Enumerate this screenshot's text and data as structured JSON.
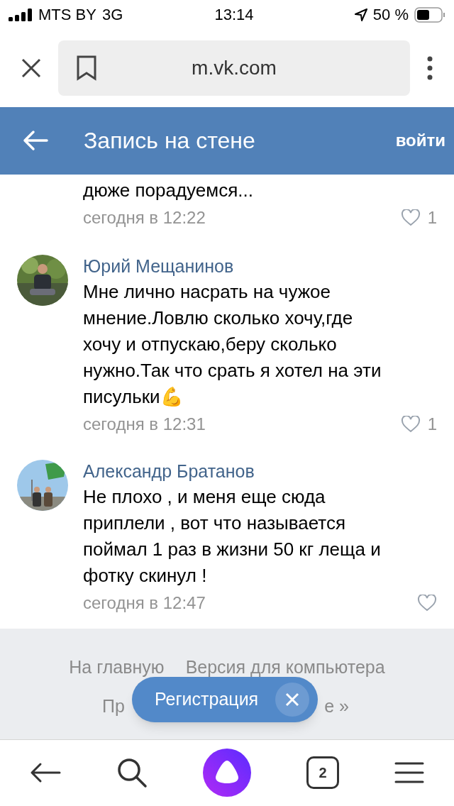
{
  "status_bar": {
    "carrier": "MTS BY",
    "network": "3G",
    "time": "13:14",
    "battery": "50 %"
  },
  "browser": {
    "url": "m.vk.com"
  },
  "header": {
    "title": "Запись на стене",
    "login": "войти"
  },
  "comments": [
    {
      "kind": "partial",
      "text": "дюже порадуемся...",
      "date": "сегодня в 12:22",
      "likes": "1"
    },
    {
      "kind": "full",
      "author": "Юрий Мещанинов",
      "text": "Мне лично насрать на чужое мнение.Ловлю сколько хочу,где хочу и отпускаю,беру сколько нужно.Так что срать я хотел на эти писульки💪",
      "date": "сегодня в 12:31",
      "likes": "1"
    },
    {
      "kind": "full",
      "author": "Александр Братанов",
      "text": "Не плохо , и меня еще сюда приплели , вот что называется поймал 1 раз в жизни 50 кг леща и фотку скинул !",
      "date": "сегодня в 12:47"
    }
  ],
  "footer": {
    "links_row_1": [
      "На главную",
      "Версия для компьютера"
    ],
    "links_row_2": [
      "Пр",
      "е »"
    ]
  },
  "popup": {
    "label": "Регистрация"
  },
  "bottom_bar": {
    "tabs_count": "2"
  }
}
